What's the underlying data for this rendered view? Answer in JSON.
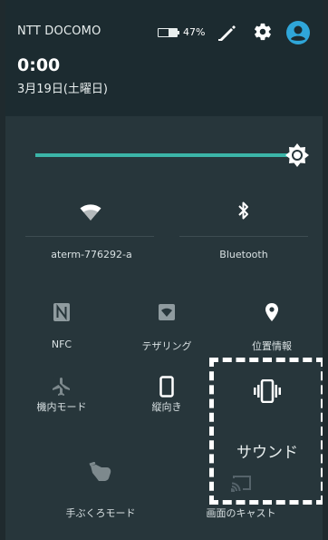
{
  "status": {
    "carrier": "NTT DOCOMO",
    "battery_percent_text": "47%",
    "battery_level": 0.47,
    "time": "0:00",
    "date": "3月19日(土曜日)"
  },
  "brightness": {
    "level": 0.98
  },
  "tiles": {
    "wifi": {
      "label": "aterm-776292-a",
      "icon": "wifi-icon"
    },
    "bluetooth": {
      "label": "Bluetooth",
      "icon": "bluetooth-icon"
    },
    "nfc": {
      "label": "NFC",
      "icon": "nfc-icon"
    },
    "tethering": {
      "label": "テザリング",
      "icon": "hotspot-icon"
    },
    "location": {
      "label": "位置情報",
      "icon": "location-pin-icon"
    },
    "airplane": {
      "label": "機内モード",
      "icon": "airplane-icon"
    },
    "rotation": {
      "label": "縦向き",
      "icon": "portrait-phone-icon"
    },
    "sound": {
      "label": "サウンド",
      "icon": "vibrate-icon"
    },
    "glove": {
      "label": "手ぶくろモード",
      "icon": "glove-hand-icon"
    },
    "cast": {
      "label": "画面のキャスト",
      "icon": "cast-icon"
    }
  },
  "colors": {
    "accent": "#3bb5a8",
    "highlight_border": "#ffffff"
  }
}
